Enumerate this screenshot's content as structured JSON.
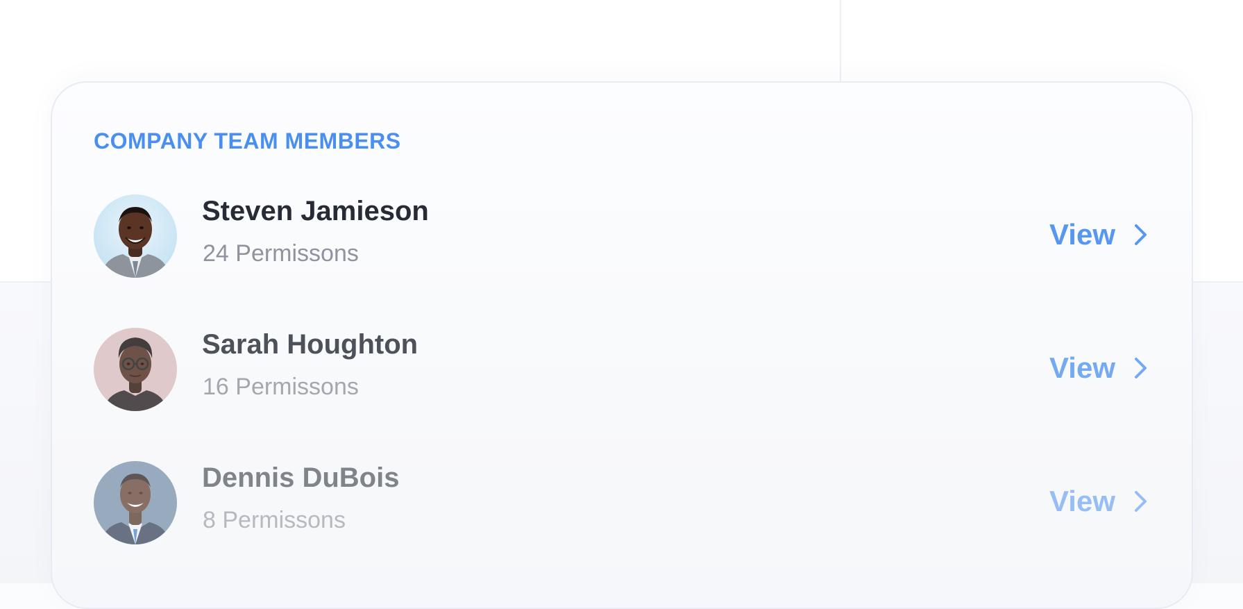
{
  "card": {
    "title": "COMPANY TEAM MEMBERS"
  },
  "members": [
    {
      "name": "Steven Jamieson",
      "permissions": "24 Permissons",
      "view_label": "View",
      "avatar_icon": "person-photo"
    },
    {
      "name": "Sarah Houghton",
      "permissions": "16 Permissons",
      "view_label": "View",
      "avatar_icon": "person-photo"
    },
    {
      "name": "Dennis DuBois",
      "permissions": "8 Permissons",
      "view_label": "View",
      "avatar_icon": "person-photo"
    }
  ],
  "colors": {
    "accent": "#4a8ff0",
    "name_text": "#262b36",
    "secondary_text": "#8e939d",
    "card_border": "#e8ebf3"
  },
  "icons": {
    "view_chevron": "chevron-right-icon"
  }
}
